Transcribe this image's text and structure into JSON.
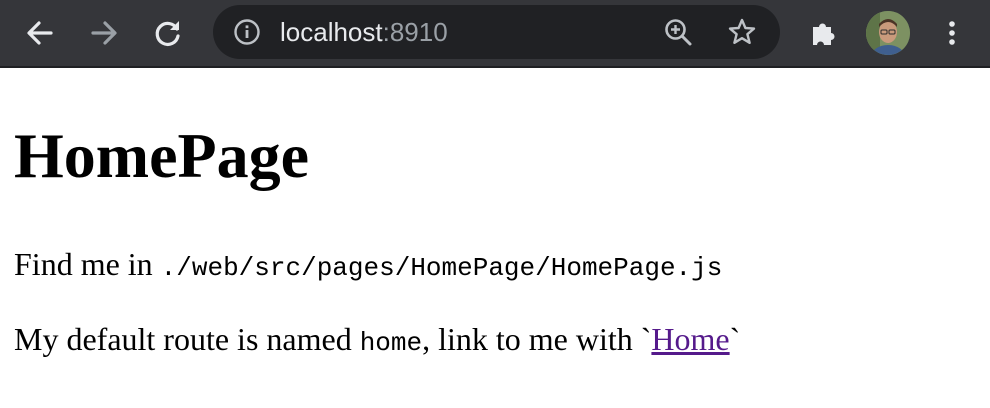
{
  "browser": {
    "url_host": "localhost",
    "url_port": ":8910",
    "icons": {
      "back": "arrow-left-icon",
      "forward": "arrow-right-icon",
      "reload": "reload-icon",
      "site_info": "info-icon",
      "zoom": "zoom-in-icon",
      "bookmark": "star-icon",
      "extensions": "puzzle-icon",
      "profile": "avatar",
      "menu": "kebab-menu-icon"
    },
    "colors": {
      "toolbar": "#35363a",
      "omnibox": "#202124",
      "icon_active": "#e8eaed",
      "icon_disabled": "#9aa0a6"
    }
  },
  "page": {
    "heading": "HomePage",
    "p1_prefix": "Find me in ",
    "p1_path": "./web/src/pages/HomePage/HomePage.js",
    "p2_prefix": "My default route is named ",
    "p2_route": "home",
    "p2_middle": ", link to me with `",
    "p2_link": "Home",
    "p2_suffix": "`",
    "link_color": "#551a8b"
  }
}
